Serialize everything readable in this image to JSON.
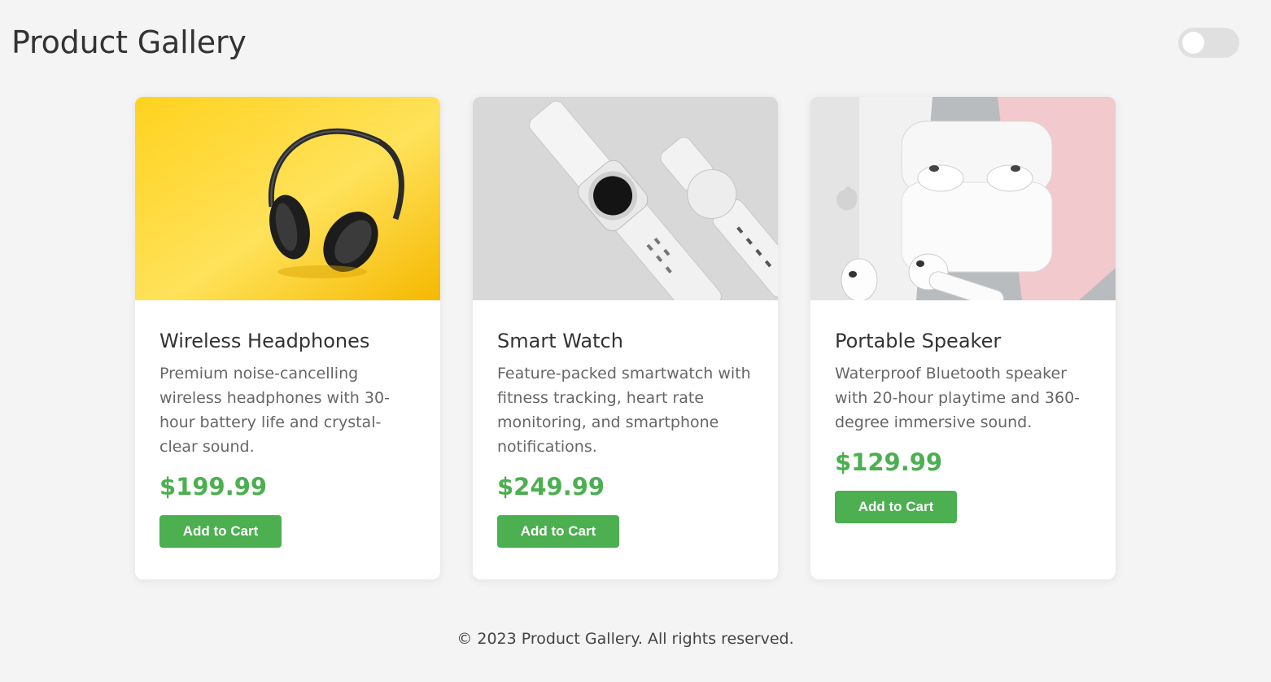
{
  "header": {
    "title": "Product Gallery",
    "theme_toggle": {
      "state": "off"
    }
  },
  "products": [
    {
      "title": "Wireless Headphones",
      "description": "Premium noise-cancelling wireless headphones with 30-hour battery life and crystal-clear sound.",
      "price": "$199.99",
      "button_label": "Add to Cart",
      "image": "headphones-image"
    },
    {
      "title": "Smart Watch",
      "description": "Feature-packed smartwatch with fitness tracking, heart rate monitoring, and smartphone notifications.",
      "price": "$249.99",
      "button_label": "Add to Cart",
      "image": "smartwatch-image"
    },
    {
      "title": "Portable Speaker",
      "description": "Waterproof Bluetooth speaker with 20-hour playtime and 360-degree immersive sound.",
      "price": "$129.99",
      "button_label": "Add to Cart",
      "image": "earbuds-image"
    }
  ],
  "footer": {
    "text": "© 2023 Product Gallery. All rights reserved."
  },
  "colors": {
    "accent": "#4caf50",
    "background": "#f4f4f4",
    "card": "#ffffff",
    "toggle_track": "#e0e0e0"
  }
}
